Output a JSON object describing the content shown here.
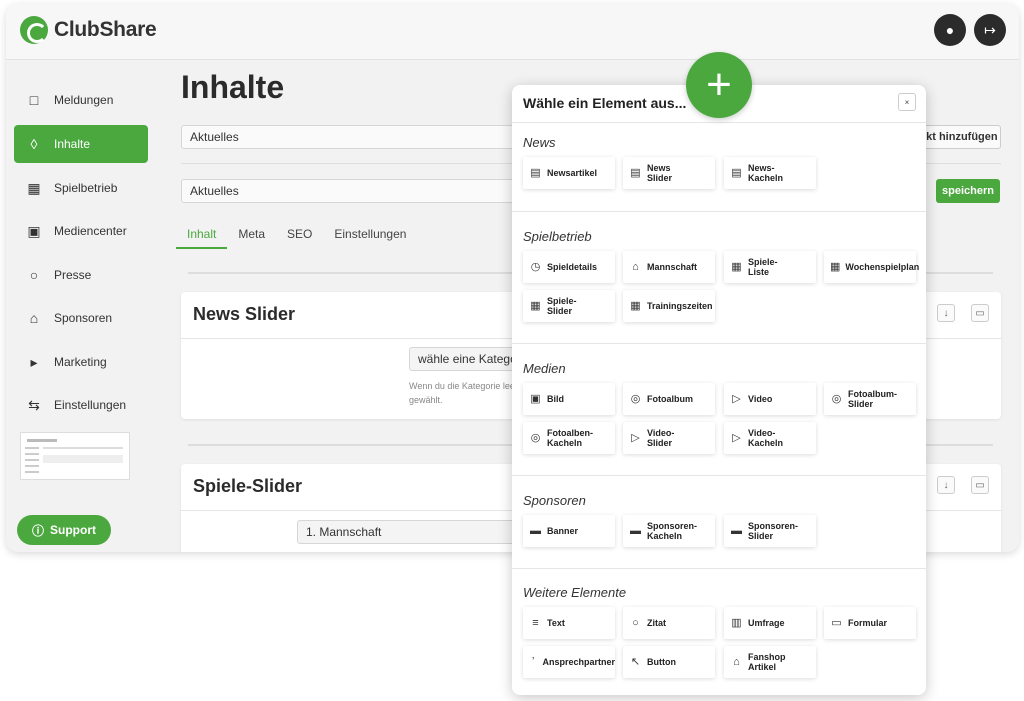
{
  "app": {
    "name": "ClubShare"
  },
  "header": {
    "profile_icon": "user-icon",
    "logout_icon": "logout-icon"
  },
  "sidebar": {
    "items": [
      {
        "label": "Meldungen",
        "icon": "document-icon"
      },
      {
        "label": "Inhalte",
        "icon": "layers-icon"
      },
      {
        "label": "Spielbetrieb",
        "icon": "calendar-icon"
      },
      {
        "label": "Mediencenter",
        "icon": "image-icon"
      },
      {
        "label": "Presse",
        "icon": "speech-bubble-icon"
      },
      {
        "label": "Sponsoren",
        "icon": "cart-icon"
      },
      {
        "label": "Marketing",
        "icon": "megaphone-icon"
      },
      {
        "label": "Einstellungen",
        "icon": "sliders-icon"
      }
    ],
    "support_label": "Support"
  },
  "main": {
    "title": "Inhalte",
    "select1_value": "Aktuelles",
    "add_point_label": "nkt hinzufügen",
    "select2_value": "Aktuelles",
    "save_label": "speichern",
    "tabs": [
      "Inhalt",
      "Meta",
      "SEO",
      "Einstellungen"
    ],
    "card1": {
      "title": "News Slider",
      "select_placeholder": "wähle eine Kategor",
      "hint": "Wenn du die Kategorie lee\ngewählt."
    },
    "card2": {
      "title": "Spiele-Slider",
      "select_value": "1. Mannschaft"
    }
  },
  "modal": {
    "title": "Wähle ein Element aus...",
    "close_label": "×",
    "sections": [
      {
        "title": "News",
        "items": [
          {
            "label": "Newsartikel",
            "icon": "file-icon"
          },
          {
            "label": "News\nSlider",
            "icon": "file-icon"
          },
          {
            "label": "News-\nKacheln",
            "icon": "file-icon"
          }
        ]
      },
      {
        "title": "Spielbetrieb",
        "items": [
          {
            "label": "Spieldetails",
            "icon": "clock-icon"
          },
          {
            "label": "Mannschaft",
            "icon": "shirt-icon"
          },
          {
            "label": "Spiele-\nListe",
            "icon": "calendar-icon"
          },
          {
            "label": "Wochenspielplan",
            "icon": "calendar-icon"
          },
          {
            "label": "Spiele-\nSlider",
            "icon": "calendar-icon"
          },
          {
            "label": "Trainingszeiten",
            "icon": "calendar-icon"
          }
        ]
      },
      {
        "title": "Medien",
        "items": [
          {
            "label": "Bild",
            "icon": "image-icon"
          },
          {
            "label": "Fotoalbum",
            "icon": "camera-icon"
          },
          {
            "label": "Video",
            "icon": "video-icon"
          },
          {
            "label": "Fotoalbum-\nSlider",
            "icon": "camera-icon"
          },
          {
            "label": "Fotoalben-\nKacheln",
            "icon": "camera-icon"
          },
          {
            "label": "Video-\nSlider",
            "icon": "video-icon"
          },
          {
            "label": "Video-\nKacheln",
            "icon": "video-icon"
          }
        ]
      },
      {
        "title": "Sponsoren",
        "items": [
          {
            "label": "Banner",
            "icon": "briefcase-icon"
          },
          {
            "label": "Sponsoren-\nKacheln",
            "icon": "briefcase-icon"
          },
          {
            "label": "Sponsoren-\nSlider",
            "icon": "briefcase-icon"
          }
        ]
      },
      {
        "title": "Weitere Elemente",
        "items": [
          {
            "label": "Text",
            "icon": "text-icon"
          },
          {
            "label": "Zitat",
            "icon": "quote-icon"
          },
          {
            "label": "Umfrage",
            "icon": "chart-icon"
          },
          {
            "label": "Formular",
            "icon": "folder-icon"
          },
          {
            "label": "Ansprechpartner",
            "icon": "contact-icon"
          },
          {
            "label": "Button",
            "icon": "pointer-icon"
          },
          {
            "label": "Fanshop\nArtikel",
            "icon": "cart-icon"
          }
        ]
      }
    ]
  },
  "colors": {
    "accent": "#4aa83f",
    "dark": "#2b2b2b"
  }
}
